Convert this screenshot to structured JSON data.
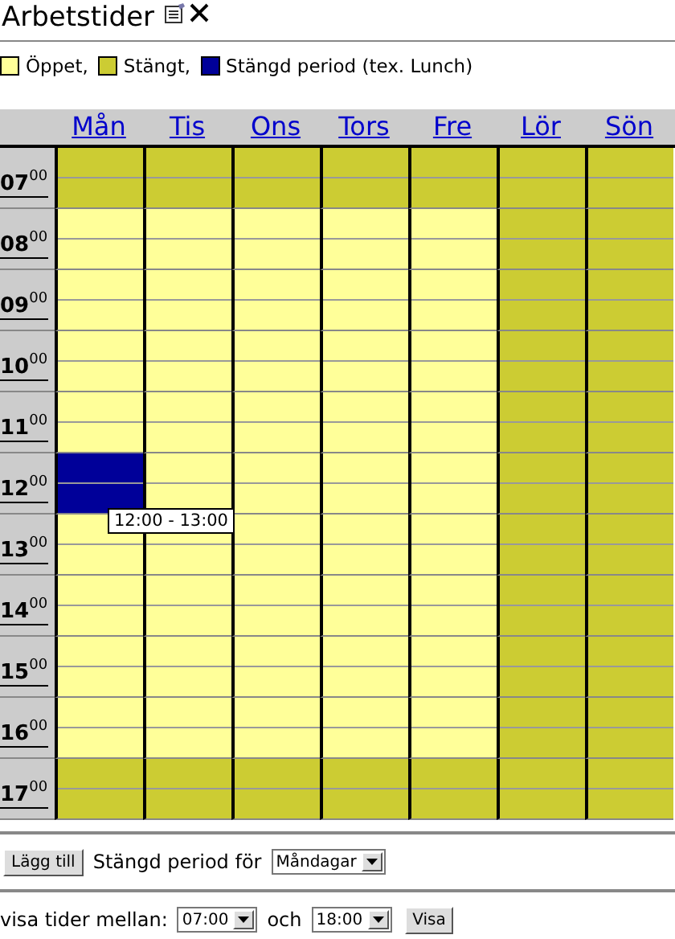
{
  "title": "Arbetstider",
  "legend": [
    {
      "label": "Öppet,",
      "color": "#ffff99"
    },
    {
      "label": "Stängt,",
      "color": "#cccc33"
    },
    {
      "label": "Stängd period (tex. Lunch)",
      "color": "#000099"
    }
  ],
  "days": [
    "Mån",
    "Tis",
    "Ons",
    "Tors",
    "Fre",
    "Lör",
    "Sön"
  ],
  "rows": [
    {
      "hour": "07",
      "minutes": "00",
      "cells": [
        {
          "kind": "closed"
        },
        {
          "kind": "closed"
        },
        {
          "kind": "closed"
        },
        {
          "kind": "closed"
        },
        {
          "kind": "closed"
        },
        {
          "kind": "closed"
        },
        {
          "kind": "closed"
        }
      ]
    },
    {
      "hour": "08",
      "minutes": "00",
      "cells": [
        {
          "kind": "open"
        },
        {
          "kind": "open"
        },
        {
          "kind": "open"
        },
        {
          "kind": "open"
        },
        {
          "kind": "open"
        },
        {
          "kind": "closed"
        },
        {
          "kind": "closed"
        }
      ]
    },
    {
      "hour": "09",
      "minutes": "00",
      "cells": [
        {
          "kind": "open"
        },
        {
          "kind": "open"
        },
        {
          "kind": "open"
        },
        {
          "kind": "open"
        },
        {
          "kind": "open"
        },
        {
          "kind": "closed"
        },
        {
          "kind": "closed"
        }
      ]
    },
    {
      "hour": "10",
      "minutes": "00",
      "cells": [
        {
          "kind": "open"
        },
        {
          "kind": "open"
        },
        {
          "kind": "open"
        },
        {
          "kind": "open"
        },
        {
          "kind": "open"
        },
        {
          "kind": "closed"
        },
        {
          "kind": "closed"
        }
      ]
    },
    {
      "hour": "11",
      "minutes": "00",
      "cells": [
        {
          "kind": "open"
        },
        {
          "kind": "open"
        },
        {
          "kind": "open"
        },
        {
          "kind": "open"
        },
        {
          "kind": "open"
        },
        {
          "kind": "closed"
        },
        {
          "kind": "closed"
        }
      ]
    },
    {
      "hour": "12",
      "minutes": "00",
      "cells": [
        {
          "kind": "period"
        },
        {
          "kind": "open"
        },
        {
          "kind": "open"
        },
        {
          "kind": "open"
        },
        {
          "kind": "open"
        },
        {
          "kind": "closed"
        },
        {
          "kind": "closed"
        }
      ]
    },
    {
      "hour": "13",
      "minutes": "00",
      "cells": [
        {
          "kind": "open"
        },
        {
          "kind": "open"
        },
        {
          "kind": "open"
        },
        {
          "kind": "open"
        },
        {
          "kind": "open"
        },
        {
          "kind": "closed"
        },
        {
          "kind": "closed"
        }
      ]
    },
    {
      "hour": "14",
      "minutes": "00",
      "cells": [
        {
          "kind": "open"
        },
        {
          "kind": "open"
        },
        {
          "kind": "open"
        },
        {
          "kind": "open"
        },
        {
          "kind": "open"
        },
        {
          "kind": "closed"
        },
        {
          "kind": "closed"
        }
      ]
    },
    {
      "hour": "15",
      "minutes": "00",
      "cells": [
        {
          "kind": "open"
        },
        {
          "kind": "open"
        },
        {
          "kind": "open"
        },
        {
          "kind": "open"
        },
        {
          "kind": "open"
        },
        {
          "kind": "closed"
        },
        {
          "kind": "closed"
        }
      ]
    },
    {
      "hour": "16",
      "minutes": "00",
      "cells": [
        {
          "kind": "open"
        },
        {
          "kind": "open"
        },
        {
          "kind": "open"
        },
        {
          "kind": "open"
        },
        {
          "kind": "open"
        },
        {
          "kind": "closed"
        },
        {
          "kind": "closed"
        }
      ]
    },
    {
      "hour": "17",
      "minutes": "00",
      "cells": [
        {
          "kind": "closed"
        },
        {
          "kind": "closed"
        },
        {
          "kind": "closed"
        },
        {
          "kind": "closed"
        },
        {
          "kind": "closed"
        },
        {
          "kind": "closed"
        },
        {
          "kind": "closed"
        }
      ]
    }
  ],
  "tooltip": "12:00 - 13:00",
  "add_button": "Lägg till",
  "period_label": "Stängd period för",
  "period_select": "Måndagar",
  "range_label": "visa tider mellan:",
  "from_select": "07:00",
  "and_label": "och",
  "to_select": "18:00",
  "show_button": "Visa"
}
